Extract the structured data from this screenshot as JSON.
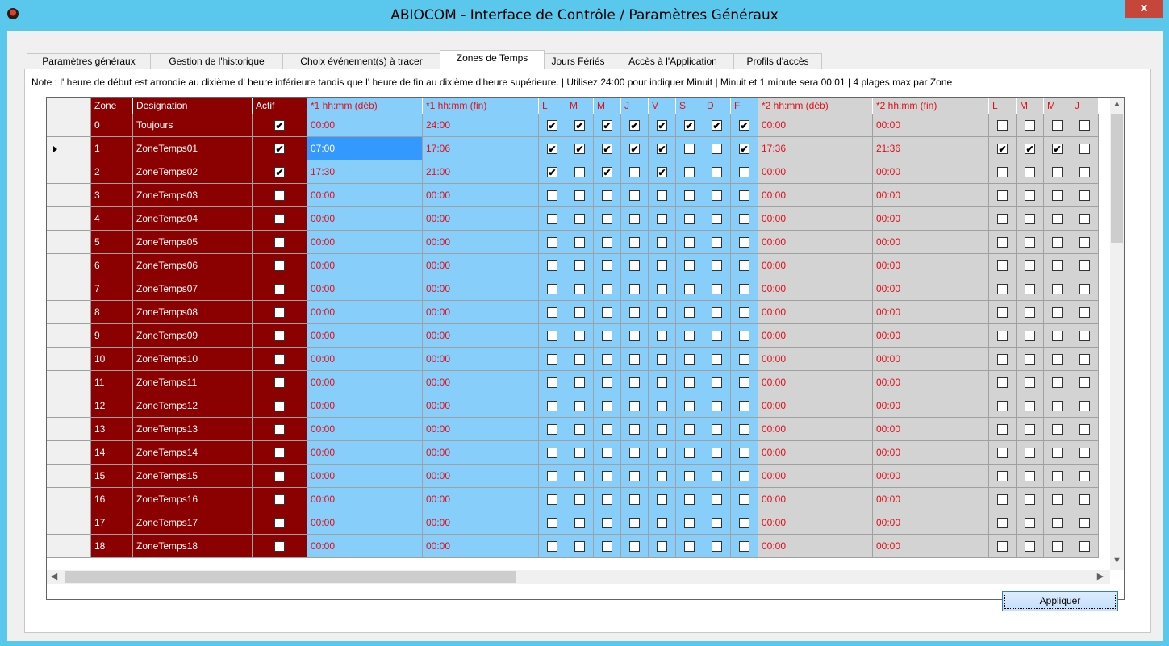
{
  "window": {
    "title": "ABIOCOM - Interface de Contrôle / Paramètres Généraux",
    "close_label": "x"
  },
  "tabs": [
    {
      "label": "Paramètres généraux",
      "active": false
    },
    {
      "label": "Gestion de l'historique",
      "active": false
    },
    {
      "label": "Choix événement(s) à tracer",
      "active": false
    },
    {
      "label": "Zones de Temps",
      "active": true
    },
    {
      "label": "Jours Fériés",
      "active": false
    },
    {
      "label": "Accès à l'Application",
      "active": false
    },
    {
      "label": "Profils d'accès",
      "active": false
    }
  ],
  "note": "Note : l' heure de début est arrondie au dixième d' heure inférieure tandis que l' heure de fin au dixième d'heure supérieure. | Utilisez 24:00 pour indiquer Minuit | Minuit et 1 minute sera 00:01 |  4 plages max par Zone",
  "grid": {
    "headers": {
      "zone": "Zone",
      "designation": "Designation",
      "actif": "Actif",
      "start1": "*1  hh:mm (déb)",
      "end1": "*1  hh:mm (fin)",
      "days1": [
        "L",
        "M",
        "M",
        "J",
        "V",
        "S",
        "D",
        "F"
      ],
      "start2": "*2  hh:mm (déb)",
      "end2": "*2  hh:mm (fin)",
      "days2": [
        "L",
        "M",
        "M",
        "J"
      ]
    },
    "selected_row": 1,
    "rows": [
      {
        "zone": "0",
        "designation": "Toujours",
        "actif": true,
        "start1": "00:00",
        "end1": "24:00",
        "days1": [
          1,
          1,
          1,
          1,
          1,
          1,
          1,
          1
        ],
        "start2": "00:00",
        "end2": "00:00",
        "days2": [
          0,
          0,
          0,
          0
        ]
      },
      {
        "zone": "1",
        "designation": "ZoneTemps01",
        "actif": true,
        "start1": "07:00",
        "end1": "17:06",
        "days1": [
          1,
          1,
          1,
          1,
          1,
          0,
          0,
          1
        ],
        "start2": "17:36",
        "end2": "21:36",
        "days2": [
          1,
          1,
          1,
          0
        ]
      },
      {
        "zone": "2",
        "designation": "ZoneTemps02",
        "actif": true,
        "start1": "17:30",
        "end1": "21:00",
        "days1": [
          1,
          0,
          1,
          0,
          1,
          0,
          0,
          0
        ],
        "start2": "00:00",
        "end2": "00:00",
        "days2": [
          0,
          0,
          0,
          0
        ]
      },
      {
        "zone": "3",
        "designation": "ZoneTemps03",
        "actif": false,
        "start1": "00:00",
        "end1": "00:00",
        "days1": [
          0,
          0,
          0,
          0,
          0,
          0,
          0,
          0
        ],
        "start2": "00:00",
        "end2": "00:00",
        "days2": [
          0,
          0,
          0,
          0
        ]
      },
      {
        "zone": "4",
        "designation": "ZoneTemps04",
        "actif": false,
        "start1": "00:00",
        "end1": "00:00",
        "days1": [
          0,
          0,
          0,
          0,
          0,
          0,
          0,
          0
        ],
        "start2": "00:00",
        "end2": "00:00",
        "days2": [
          0,
          0,
          0,
          0
        ]
      },
      {
        "zone": "5",
        "designation": "ZoneTemps05",
        "actif": false,
        "start1": "00:00",
        "end1": "00:00",
        "days1": [
          0,
          0,
          0,
          0,
          0,
          0,
          0,
          0
        ],
        "start2": "00:00",
        "end2": "00:00",
        "days2": [
          0,
          0,
          0,
          0
        ]
      },
      {
        "zone": "6",
        "designation": "ZoneTemps06",
        "actif": false,
        "start1": "00:00",
        "end1": "00:00",
        "days1": [
          0,
          0,
          0,
          0,
          0,
          0,
          0,
          0
        ],
        "start2": "00:00",
        "end2": "00:00",
        "days2": [
          0,
          0,
          0,
          0
        ]
      },
      {
        "zone": "7",
        "designation": "ZoneTemps07",
        "actif": false,
        "start1": "00:00",
        "end1": "00:00",
        "days1": [
          0,
          0,
          0,
          0,
          0,
          0,
          0,
          0
        ],
        "start2": "00:00",
        "end2": "00:00",
        "days2": [
          0,
          0,
          0,
          0
        ]
      },
      {
        "zone": "8",
        "designation": "ZoneTemps08",
        "actif": false,
        "start1": "00:00",
        "end1": "00:00",
        "days1": [
          0,
          0,
          0,
          0,
          0,
          0,
          0,
          0
        ],
        "start2": "00:00",
        "end2": "00:00",
        "days2": [
          0,
          0,
          0,
          0
        ]
      },
      {
        "zone": "9",
        "designation": "ZoneTemps09",
        "actif": false,
        "start1": "00:00",
        "end1": "00:00",
        "days1": [
          0,
          0,
          0,
          0,
          0,
          0,
          0,
          0
        ],
        "start2": "00:00",
        "end2": "00:00",
        "days2": [
          0,
          0,
          0,
          0
        ]
      },
      {
        "zone": "10",
        "designation": "ZoneTemps10",
        "actif": false,
        "start1": "00:00",
        "end1": "00:00",
        "days1": [
          0,
          0,
          0,
          0,
          0,
          0,
          0,
          0
        ],
        "start2": "00:00",
        "end2": "00:00",
        "days2": [
          0,
          0,
          0,
          0
        ]
      },
      {
        "zone": "11",
        "designation": "ZoneTemps11",
        "actif": false,
        "start1": "00:00",
        "end1": "00:00",
        "days1": [
          0,
          0,
          0,
          0,
          0,
          0,
          0,
          0
        ],
        "start2": "00:00",
        "end2": "00:00",
        "days2": [
          0,
          0,
          0,
          0
        ]
      },
      {
        "zone": "12",
        "designation": "ZoneTemps12",
        "actif": false,
        "start1": "00:00",
        "end1": "00:00",
        "days1": [
          0,
          0,
          0,
          0,
          0,
          0,
          0,
          0
        ],
        "start2": "00:00",
        "end2": "00:00",
        "days2": [
          0,
          0,
          0,
          0
        ]
      },
      {
        "zone": "13",
        "designation": "ZoneTemps13",
        "actif": false,
        "start1": "00:00",
        "end1": "00:00",
        "days1": [
          0,
          0,
          0,
          0,
          0,
          0,
          0,
          0
        ],
        "start2": "00:00",
        "end2": "00:00",
        "days2": [
          0,
          0,
          0,
          0
        ]
      },
      {
        "zone": "14",
        "designation": "ZoneTemps14",
        "actif": false,
        "start1": "00:00",
        "end1": "00:00",
        "days1": [
          0,
          0,
          0,
          0,
          0,
          0,
          0,
          0
        ],
        "start2": "00:00",
        "end2": "00:00",
        "days2": [
          0,
          0,
          0,
          0
        ]
      },
      {
        "zone": "15",
        "designation": "ZoneTemps15",
        "actif": false,
        "start1": "00:00",
        "end1": "00:00",
        "days1": [
          0,
          0,
          0,
          0,
          0,
          0,
          0,
          0
        ],
        "start2": "00:00",
        "end2": "00:00",
        "days2": [
          0,
          0,
          0,
          0
        ]
      },
      {
        "zone": "16",
        "designation": "ZoneTemps16",
        "actif": false,
        "start1": "00:00",
        "end1": "00:00",
        "days1": [
          0,
          0,
          0,
          0,
          0,
          0,
          0,
          0
        ],
        "start2": "00:00",
        "end2": "00:00",
        "days2": [
          0,
          0,
          0,
          0
        ]
      },
      {
        "zone": "17",
        "designation": "ZoneTemps17",
        "actif": false,
        "start1": "00:00",
        "end1": "00:00",
        "days1": [
          0,
          0,
          0,
          0,
          0,
          0,
          0,
          0
        ],
        "start2": "00:00",
        "end2": "00:00",
        "days2": [
          0,
          0,
          0,
          0
        ]
      },
      {
        "zone": "18",
        "designation": "ZoneTemps18",
        "actif": false,
        "start1": "00:00",
        "end1": "00:00",
        "days1": [
          0,
          0,
          0,
          0,
          0,
          0,
          0,
          0
        ],
        "start2": "00:00",
        "end2": "00:00",
        "days2": [
          0,
          0,
          0,
          0
        ]
      }
    ]
  },
  "apply_button": "Appliquer",
  "colors": {
    "title_bar": "#5ac8ec",
    "zone_column": "#8b0000",
    "range1": "#87cefa",
    "range2": "#d3d3d3",
    "time_text": "#e0101a"
  },
  "icons": {
    "app": "app-logo-icon",
    "check": "check-icon",
    "row_pointer": "row-pointer-icon"
  }
}
